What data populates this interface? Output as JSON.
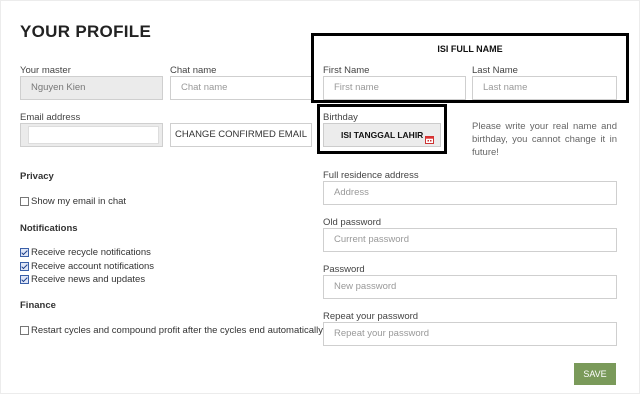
{
  "page": {
    "title": "YOUR PROFILE"
  },
  "left": {
    "master_label": "Your master",
    "master_value": "Nguyen Kien",
    "chat_label": "Chat name",
    "chat_placeholder": "Chat name",
    "email_label": "Email address",
    "email_value": "",
    "change_email_button": "CHANGE CONFIRMED EMAIL",
    "privacy_heading": "Privacy",
    "privacy_items": [
      {
        "label": "Show my email in chat",
        "checked": false
      }
    ],
    "notifications_heading": "Notifications",
    "notification_items": [
      {
        "label": "Receive recycle notifications",
        "checked": true
      },
      {
        "label": "Receive account notifications",
        "checked": true
      },
      {
        "label": "Receive news and updates",
        "checked": true
      }
    ],
    "finance_heading": "Finance",
    "finance_items": [
      {
        "label": "Restart cycles and compound profit after the cycles end automatically",
        "checked": false
      }
    ]
  },
  "right": {
    "annotation_fullname": "ISI FULL NAME",
    "first_name_label": "First Name",
    "first_name_placeholder": "First name",
    "last_name_label": "Last Name",
    "last_name_placeholder": "Last name",
    "birthday_label": "Birthday",
    "birthday_annotation": "ISI TANGGAL LAHIR",
    "birthday_note": "Please write your real name and birthday, you cannot change it in future!",
    "address_label": "Full residence address",
    "address_placeholder": "Address",
    "old_password_label": "Old password",
    "old_password_placeholder": "Current password",
    "password_label": "Password",
    "password_placeholder": "New password",
    "repeat_password_label": "Repeat your password",
    "repeat_password_placeholder": "Repeat your password",
    "save_button": "SAVE"
  },
  "colors": {
    "save_button": "#7a9a5a",
    "annotation_border": "#000000",
    "disabled_input": "#ebebeb"
  },
  "icons": {
    "calendar": "calendar-icon"
  }
}
